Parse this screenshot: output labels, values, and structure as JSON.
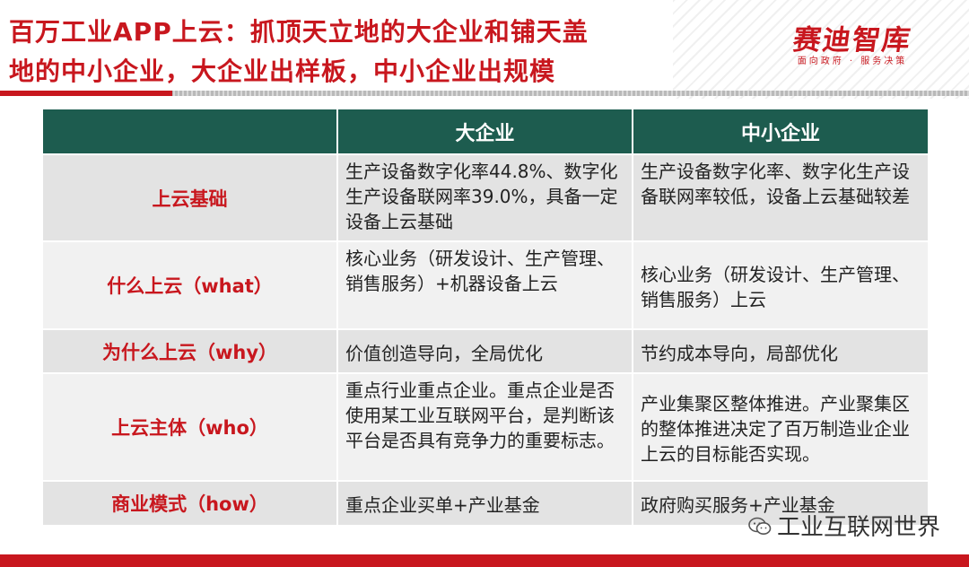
{
  "title": {
    "line1": "百万工业APP上云：抓顶天立地的大企业和铺天盖",
    "line2": "地的中小企业，大企业出样板，中小企业出规模"
  },
  "logo": {
    "name": "赛迪智库",
    "slogan": "面向政府 · 服务决策"
  },
  "table": {
    "headers": [
      "",
      "大企业",
      "中小企业"
    ],
    "rows": [
      {
        "label": "上云基础",
        "large": "生产设备数字化率44.8%、数字化生产设备联网率39.0%，具备一定设备上云基础",
        "small": "生产设备数字化率、数字化生产设备联网率较低，设备上云基础较差"
      },
      {
        "label": "什么上云（what）",
        "large": "核心业务（研发设计、生产管理、销售服务）+机器设备上云",
        "small": "核心业务（研发设计、生产管理、销售服务）上云"
      },
      {
        "label": "为什么上云（why）",
        "large": "价值创造导向，全局优化",
        "small": "节约成本导向，局部优化"
      },
      {
        "label": "上云主体（who）",
        "large": "重点行业重点企业。重点企业是否使用某工业互联网平台，是判断该平台是否具有竞争力的重要标志。",
        "small": "产业集聚区整体推进。产业聚集区的整体推进决定了百万制造业企业上云的目标能否实现。"
      },
      {
        "label": "商业模式（how）",
        "large": "重点企业买单+产业基金",
        "small": "政府购买服务+产业基金"
      }
    ]
  },
  "footer": {
    "source": "工业互联网世界",
    "icon": "wechat-icon"
  },
  "colors": {
    "accent_red": "#c8171e",
    "header_green": "#1d5c4f"
  }
}
